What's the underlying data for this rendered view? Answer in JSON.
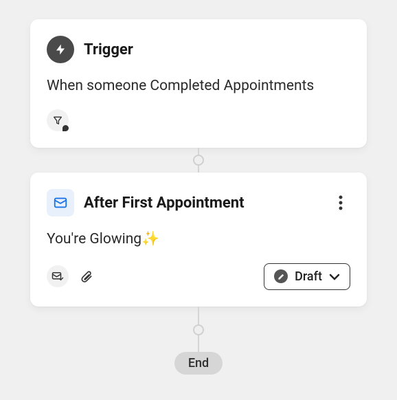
{
  "trigger": {
    "title": "Trigger",
    "description": "When someone Completed Appointments"
  },
  "step": {
    "title": "After First Appointment",
    "body": "You're Glowing✨",
    "status": "Draft"
  },
  "end": {
    "label": "End"
  }
}
